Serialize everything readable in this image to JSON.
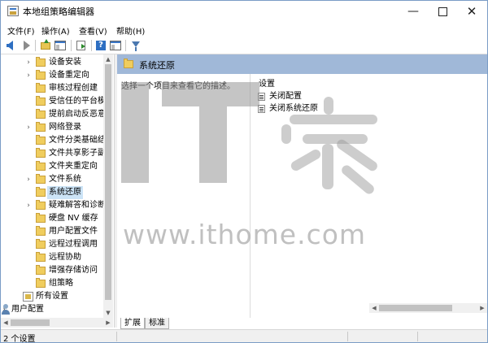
{
  "window": {
    "title": "本地组策略编辑器",
    "controls": {
      "minimize": "—",
      "close": "✕"
    }
  },
  "menu": [
    "文件(F)",
    "操作(A)",
    "查看(V)",
    "帮助(H)"
  ],
  "tree": {
    "items": [
      {
        "label": "设备安装",
        "expandable": true
      },
      {
        "label": "设备重定向",
        "expandable": true
      },
      {
        "label": "审核过程创建",
        "expandable": false
      },
      {
        "label": "受信任的平台模",
        "expandable": false
      },
      {
        "label": "提前启动反恶意",
        "expandable": false
      },
      {
        "label": "网络登录",
        "expandable": true
      },
      {
        "label": "文件分类基础结",
        "expandable": false
      },
      {
        "label": "文件共享影子副",
        "expandable": false
      },
      {
        "label": "文件夹重定向",
        "expandable": false
      },
      {
        "label": "文件系统",
        "expandable": true
      },
      {
        "label": "系统还原",
        "expandable": false,
        "selected": true
      },
      {
        "label": "疑难解答和诊断",
        "expandable": true
      },
      {
        "label": "硬盘 NV 缓存",
        "expandable": false
      },
      {
        "label": "用户配置文件",
        "expandable": false
      },
      {
        "label": "远程过程调用",
        "expandable": false
      },
      {
        "label": "远程协助",
        "expandable": false
      },
      {
        "label": "增强存储访问",
        "expandable": false
      },
      {
        "label": "组策略",
        "expandable": false
      }
    ],
    "all_settings": "所有设置",
    "user_config": "用户配置"
  },
  "right": {
    "header_title": "系统还原",
    "description": "选择一个项目来查看它的描述。",
    "column_header": "设置",
    "settings": [
      "关闭配置",
      "关闭系统还原"
    ]
  },
  "tabs": [
    "扩展",
    "标准"
  ],
  "status": {
    "text": "2 个设置"
  },
  "watermark": {
    "url": "www.ithome.com"
  }
}
